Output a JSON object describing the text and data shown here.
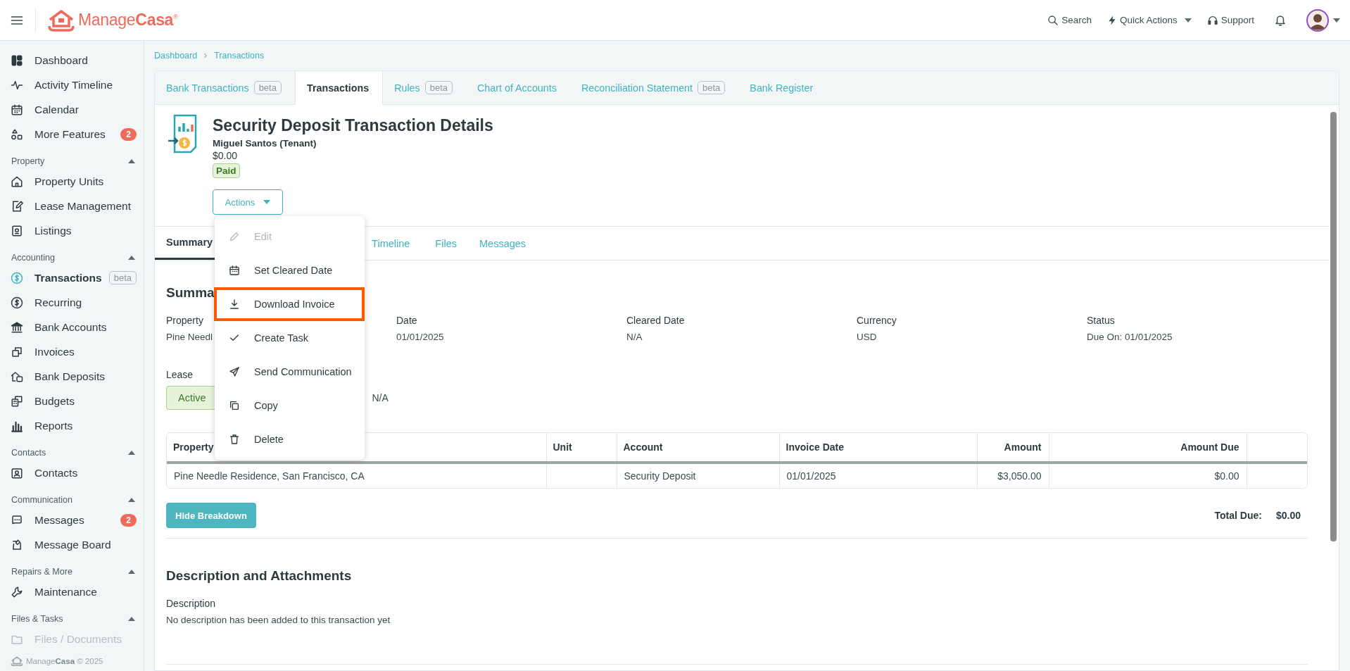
{
  "top_bar": {
    "logo": "Manage**Casa**$^{®}$",
    "actions": [
      {
        "label": "Search",
        "dropdown": false
      },
      {
        "label": "Quick Actions",
        "dropdown": true
      },
      {
        "label": "Support",
        "dropdown": false
      }
    ]
  },
  "sidebar": {
    "items": [
      {
        "label": "Dashboard",
        "selected": false
      },
      {
        "label": "Activity Timeline",
        "selected": false
      },
      {
        "label": "Calendar",
        "selected": false
      },
      {
        "label": "More Features",
        "selected": false,
        "badge": "2"
      }
    ],
    "sections": [
      {
        "title": "Property",
        "expanded": true,
        "items": [
          {
            "label": "Property Units",
            "selected": false
          },
          {
            "label": "Lease Management",
            "selected": false
          },
          {
            "label": "Listings",
            "selected": false
          }
        ]
      },
      {
        "title": "Accounting",
        "expanded": true,
        "items": [
          {
            "label": "Transactions",
            "selected": true,
            "tag": "beta"
          },
          {
            "label": "Recurring",
            "selected": false
          },
          {
            "label": "Bank Accounts",
            "selected": false
          },
          {
            "label": "Invoices",
            "selected": false
          },
          {
            "label": "Bank Deposits",
            "selected": false
          },
          {
            "label": "Budgets",
            "selected": false
          },
          {
            "label": "Reports",
            "selected": false
          }
        ]
      },
      {
        "title": "Contacts",
        "expanded": true,
        "items": [
          {
            "label": "Contacts",
            "selected": false
          }
        ]
      },
      {
        "title": "Communication",
        "expanded": true,
        "items": [
          {
            "label": "Messages",
            "selected": false,
            "badge": "2"
          },
          {
            "label": "Message Board",
            "selected": false
          }
        ]
      },
      {
        "title": "Repairs & More",
        "expanded": true,
        "items": [
          {
            "label": "Maintenance",
            "selected": false
          }
        ]
      },
      {
        "title": "Files & Tasks",
        "expanded": true,
        "items": [
          {
            "label": "Files / Documents",
            "selected": false,
            "dimmed": true
          }
        ]
      }
    ],
    "footer": "Manage**Casa** © 2025"
  },
  "breadcrumb": [
    "Dashboard",
    "Transactions"
  ],
  "tabs": [
    {
      "label": "Bank Transactions",
      "tag": "beta",
      "selected": false
    },
    {
      "label": "Transactions",
      "selected": true
    },
    {
      "label": "Rules",
      "tag": "beta",
      "selected": false
    },
    {
      "label": "Chart of Accounts",
      "selected": false
    },
    {
      "label": "Reconciliation Statement",
      "tag": "beta",
      "selected": false
    },
    {
      "label": "Bank Register",
      "selected": false
    }
  ],
  "transaction": {
    "title": "Security Deposit Transaction Details",
    "contact": "Miguel Santos (Tenant)",
    "amount": "$0.00",
    "status": "Paid",
    "actions_button": "Actions"
  },
  "actions_menu": [
    {
      "label": "Edit",
      "disabled": true,
      "highlighted": false
    },
    {
      "label": "Set Cleared Date",
      "disabled": false,
      "highlighted": false
    },
    {
      "label": "Download Invoice",
      "disabled": false,
      "highlighted": true
    },
    {
      "label": "Create Task",
      "disabled": false,
      "highlighted": false
    },
    {
      "label": "Send Communication",
      "disabled": false,
      "highlighted": false
    },
    {
      "label": "Copy",
      "disabled": false,
      "highlighted": false
    },
    {
      "label": "Delete",
      "disabled": false,
      "highlighted": false
    }
  ],
  "subtabs": [
    {
      "label": "Summary",
      "selected": true
    },
    {
      "label": "Timeline",
      "selected": false
    },
    {
      "label": "Files",
      "selected": false
    },
    {
      "label": "Messages",
      "selected": false
    }
  ],
  "summary": {
    "heading": "Summa",
    "fields": [
      {
        "label": "Property",
        "value": "Pine Needl"
      },
      {
        "label": "Date",
        "value": "01/01/2025"
      },
      {
        "label": "Cleared Date",
        "value": "N/A"
      },
      {
        "label": "Currency",
        "value": "USD"
      },
      {
        "label": "Status",
        "value": "Due On: 01/01/2025"
      }
    ],
    "lease": {
      "label": "Lease",
      "badge": "Active",
      "value": "N/A"
    }
  },
  "table": {
    "columns": [
      "Property",
      "Unit",
      "Account",
      "Invoice Date",
      "Amount",
      "Amount Due"
    ],
    "rows": [
      [
        "Pine Needle Residence, San Francisco, CA",
        "",
        "Security Deposit",
        "01/01/2025",
        "$3,050.00",
        "$0.00"
      ]
    ]
  },
  "breakdown_button": "Hide Breakdown",
  "total": {
    "label": "Total Due:",
    "value": "$0.00"
  },
  "description": {
    "heading": "Description and Attachments",
    "label": "Description",
    "text": "No description has been added to this transaction yet"
  }
}
